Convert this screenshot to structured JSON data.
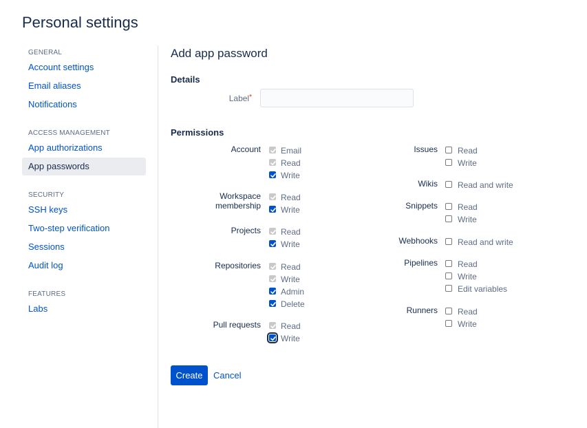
{
  "page_title": "Personal settings",
  "sidebar": {
    "sections": [
      {
        "heading": "GENERAL",
        "items": [
          {
            "label": "Account settings"
          },
          {
            "label": "Email aliases"
          },
          {
            "label": "Notifications"
          }
        ]
      },
      {
        "heading": "ACCESS MANAGEMENT",
        "items": [
          {
            "label": "App authorizations"
          },
          {
            "label": "App passwords",
            "active": true
          }
        ]
      },
      {
        "heading": "SECURITY",
        "items": [
          {
            "label": "SSH keys"
          },
          {
            "label": "Two-step verification"
          },
          {
            "label": "Sessions"
          },
          {
            "label": "Audit log"
          }
        ]
      },
      {
        "heading": "FEATURES",
        "items": [
          {
            "label": "Labs"
          }
        ]
      }
    ]
  },
  "main": {
    "title": "Add app password",
    "details_heading": "Details",
    "label_field": {
      "label": "Label",
      "required_mark": "*",
      "value": "",
      "placeholder": ""
    },
    "permissions_heading": "Permissions",
    "left_groups": [
      {
        "name": "Account",
        "options": [
          {
            "label": "Email",
            "state": "disabled-checked"
          },
          {
            "label": "Read",
            "state": "disabled-checked"
          },
          {
            "label": "Write",
            "state": "checked"
          }
        ]
      },
      {
        "name": "Workspace membership",
        "name_lines": [
          "Workspace",
          "membership"
        ],
        "options": [
          {
            "label": "Read",
            "state": "disabled-checked"
          },
          {
            "label": "Write",
            "state": "checked"
          }
        ]
      },
      {
        "name": "Projects",
        "options": [
          {
            "label": "Read",
            "state": "disabled-checked"
          },
          {
            "label": "Write",
            "state": "checked"
          }
        ]
      },
      {
        "name": "Repositories",
        "options": [
          {
            "label": "Read",
            "state": "disabled-checked"
          },
          {
            "label": "Write",
            "state": "disabled-checked"
          },
          {
            "label": "Admin",
            "state": "checked"
          },
          {
            "label": "Delete",
            "state": "checked"
          }
        ]
      },
      {
        "name": "Pull requests",
        "options": [
          {
            "label": "Read",
            "state": "disabled-checked"
          },
          {
            "label": "Write",
            "state": "checked-focused"
          }
        ]
      }
    ],
    "right_groups": [
      {
        "name": "Issues",
        "options": [
          {
            "label": "Read",
            "state": "unchecked"
          },
          {
            "label": "Write",
            "state": "unchecked"
          }
        ]
      },
      {
        "name": "Wikis",
        "options": [
          {
            "label": "Read and write",
            "state": "unchecked"
          }
        ]
      },
      {
        "name": "Snippets",
        "options": [
          {
            "label": "Read",
            "state": "unchecked"
          },
          {
            "label": "Write",
            "state": "unchecked"
          }
        ]
      },
      {
        "name": "Webhooks",
        "options": [
          {
            "label": "Read and write",
            "state": "unchecked"
          }
        ]
      },
      {
        "name": "Pipelines",
        "options": [
          {
            "label": "Read",
            "state": "unchecked"
          },
          {
            "label": "Write",
            "state": "unchecked"
          },
          {
            "label": "Edit variables",
            "state": "unchecked"
          }
        ]
      },
      {
        "name": "Runners",
        "options": [
          {
            "label": "Read",
            "state": "unchecked"
          },
          {
            "label": "Write",
            "state": "unchecked"
          }
        ]
      }
    ],
    "create_label": "Create",
    "cancel_label": "Cancel"
  },
  "colors": {
    "accent": "#0052cc",
    "text": "#172b4d",
    "muted": "#5e6c84",
    "required": "#de350b"
  }
}
